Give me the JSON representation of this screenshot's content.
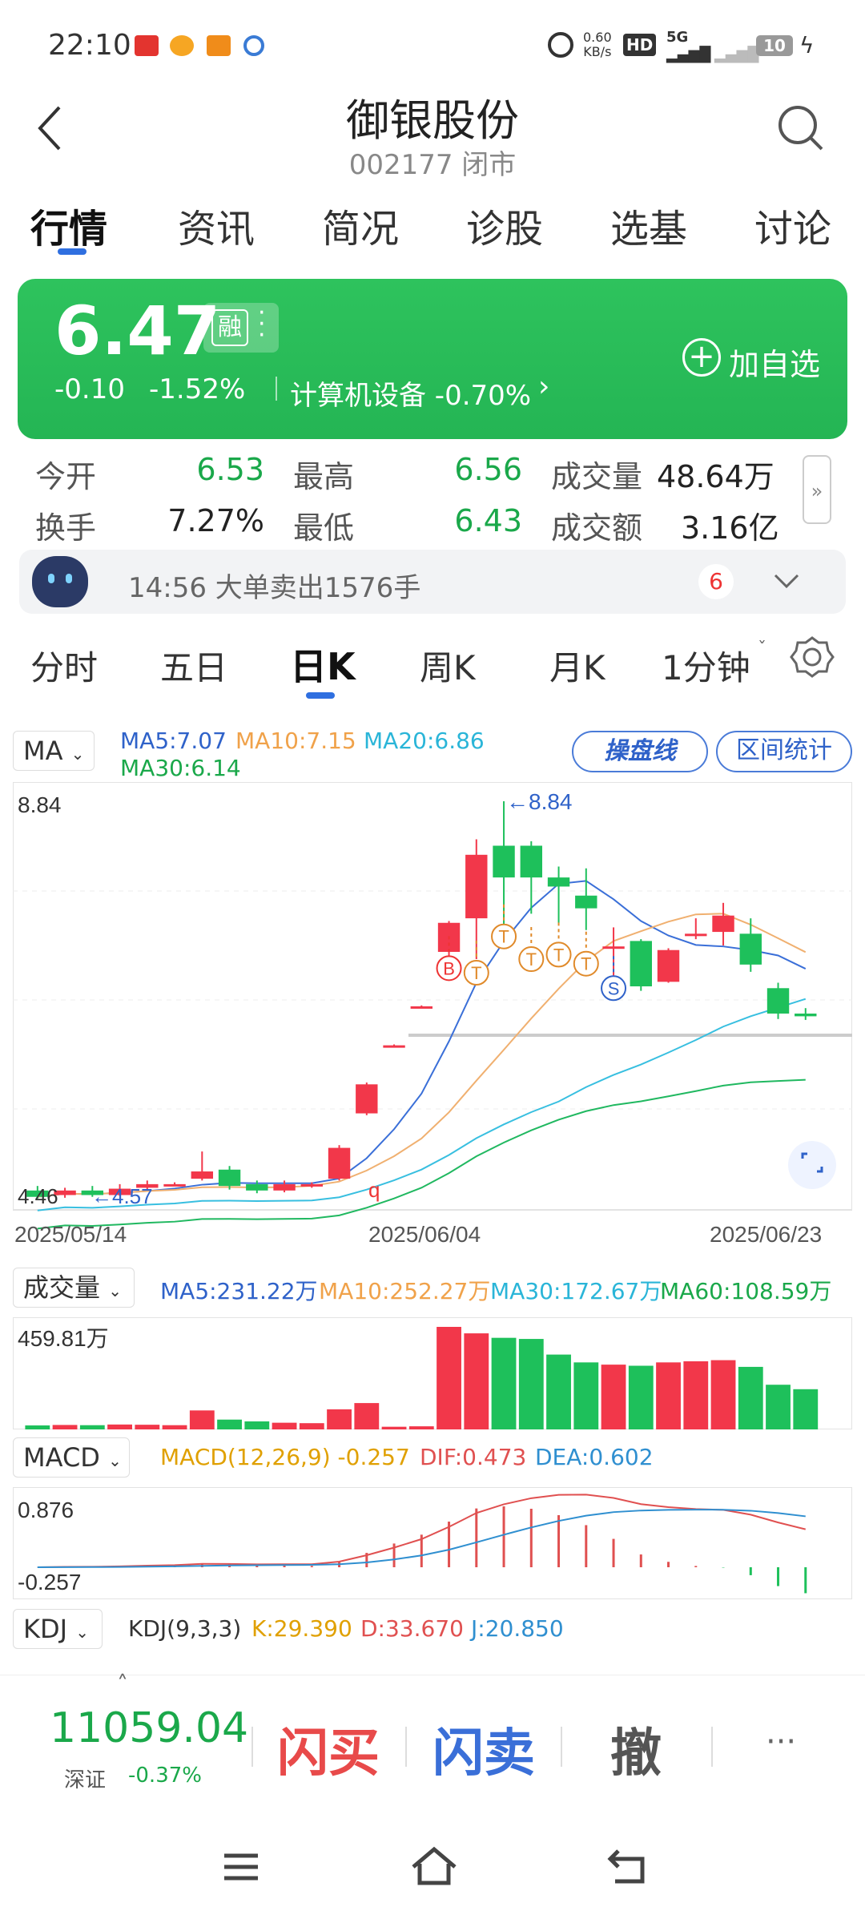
{
  "status": {
    "time": "22:10",
    "net_speed": "0.60",
    "net_unit": "KB/s",
    "hd": "HD",
    "sig": "5G",
    "battery": "10"
  },
  "header": {
    "title": "御银股份",
    "subtitle": "002177 闭市"
  },
  "tabs": [
    "行情",
    "资讯",
    "简况",
    "诊股",
    "选基",
    "讨论"
  ],
  "quote": {
    "price": "6.47",
    "rong": "融",
    "change": "-0.10",
    "pct": "-1.52%",
    "sector": "计算机设备 -0.70%",
    "add_label": "加自选"
  },
  "stats": [
    {
      "label": "今开",
      "value": "6.53"
    },
    {
      "label": "最高",
      "value": "6.56"
    },
    {
      "label": "成交量",
      "value": "48.64万"
    },
    {
      "label": "换手",
      "value": "7.27%"
    },
    {
      "label": "最低",
      "value": "6.43"
    },
    {
      "label": "成交额",
      "value": "3.16亿"
    }
  ],
  "alert": {
    "text": "14:56 大单卖出1576手",
    "badge": "6"
  },
  "period_tabs": [
    "分时",
    "五日",
    "日K",
    "周K",
    "月K",
    "1分钟"
  ],
  "ma": {
    "selector": "MA",
    "ma5": "MA5:7.07",
    "ma10": "MA10:7.15",
    "ma20": "MA20:6.86",
    "ma30": "MA30:6.14",
    "caopan": "操盘线",
    "qujian": "区间统计"
  },
  "kline": {
    "max_label": "8.84",
    "max_arrow": "←8.84",
    "min_label": "4.46",
    "min_arrow": "←4.57",
    "dates": [
      "2025/05/14",
      "2025/06/04",
      "2025/06/23"
    ],
    "signal_q": "q",
    "signals": [
      "B",
      "T",
      "T",
      "T",
      "T",
      "T",
      "S"
    ]
  },
  "volume": {
    "selector": "成交量",
    "ma5": "MA5:231.22万",
    "ma10": "MA10:252.27万",
    "ma30": "MA30:172.67万",
    "ma60": "MA60:108.59万",
    "max_label": "459.81万"
  },
  "macd": {
    "selector": "MACD",
    "params": "MACD(12,26,9) -0.257",
    "dif": "DIF:0.473",
    "dea": "DEA:0.602",
    "top": "0.876",
    "bottom": "-0.257"
  },
  "kdj": {
    "selector": "KDJ",
    "params": "KDJ(9,3,3)",
    "k": "K:29.390",
    "d": "D:33.670",
    "j": "J:20.850"
  },
  "bottom": {
    "index_value": "11059.04",
    "index_name": "深证",
    "index_pct": "-0.37%",
    "buy": "闪买",
    "sell": "闪卖",
    "cancel": "撤",
    "more": "···"
  },
  "chart_data": {
    "type": "candlestick",
    "date_range": [
      "2025/05/14",
      "2025/06/23"
    ],
    "y_range": [
      4.46,
      8.84
    ],
    "candles": [
      {
        "o": 4.55,
        "c": 4.48,
        "h": 4.6,
        "l": 4.46
      },
      {
        "o": 4.5,
        "c": 4.55,
        "h": 4.58,
        "l": 4.47
      },
      {
        "o": 4.55,
        "c": 4.5,
        "h": 4.6,
        "l": 4.48
      },
      {
        "o": 4.5,
        "c": 4.57,
        "h": 4.62,
        "l": 4.49
      },
      {
        "o": 4.58,
        "c": 4.62,
        "h": 4.66,
        "l": 4.55
      },
      {
        "o": 4.62,
        "c": 4.62,
        "h": 4.64,
        "l": 4.6
      },
      {
        "o": 4.68,
        "c": 4.76,
        "h": 4.98,
        "l": 4.66
      },
      {
        "o": 4.78,
        "c": 4.6,
        "h": 4.82,
        "l": 4.56
      },
      {
        "o": 4.62,
        "c": 4.55,
        "h": 4.66,
        "l": 4.52
      },
      {
        "o": 4.55,
        "c": 4.62,
        "h": 4.66,
        "l": 4.53
      },
      {
        "o": 4.6,
        "c": 4.62,
        "h": 4.64,
        "l": 4.58
      },
      {
        "o": 4.68,
        "c": 5.02,
        "h": 5.05,
        "l": 4.66
      },
      {
        "o": 5.4,
        "c": 5.72,
        "h": 5.74,
        "l": 5.38
      },
      {
        "o": 6.15,
        "c": 6.15,
        "h": 6.16,
        "l": 6.14
      },
      {
        "o": 6.58,
        "c": 6.58,
        "h": 6.59,
        "l": 6.57
      },
      {
        "o": 7.18,
        "c": 7.5,
        "h": 7.52,
        "l": 7.1
      },
      {
        "o": 7.55,
        "c": 8.25,
        "h": 8.42,
        "l": 7.1
      },
      {
        "o": 8.35,
        "c": 8.0,
        "h": 8.84,
        "l": 7.42
      },
      {
        "o": 8.35,
        "c": 8.0,
        "h": 8.4,
        "l": 7.6
      },
      {
        "o": 8.0,
        "c": 7.9,
        "h": 8.12,
        "l": 7.5
      },
      {
        "o": 7.8,
        "c": 7.66,
        "h": 8.1,
        "l": 7.42
      },
      {
        "o": 7.24,
        "c": 7.24,
        "h": 7.45,
        "l": 6.92
      },
      {
        "o": 7.3,
        "c": 6.8,
        "h": 7.32,
        "l": 6.75
      },
      {
        "o": 6.85,
        "c": 7.2,
        "h": 7.22,
        "l": 6.84
      },
      {
        "o": 7.38,
        "c": 7.38,
        "h": 7.55,
        "l": 7.32
      },
      {
        "o": 7.4,
        "c": 7.58,
        "h": 7.72,
        "l": 7.25
      },
      {
        "o": 7.38,
        "c": 7.04,
        "h": 7.55,
        "l": 6.96
      },
      {
        "o": 6.78,
        "c": 6.5,
        "h": 6.84,
        "l": 6.44
      },
      {
        "o": 6.5,
        "c": 6.47,
        "h": 6.56,
        "l": 6.43
      }
    ],
    "volume_series": [
      18,
      20,
      19,
      22,
      21,
      19,
      85,
      44,
      36,
      30,
      28,
      90,
      118,
      12,
      14,
      459,
      430,
      410,
      405,
      335,
      300,
      290,
      285,
      300,
      305,
      310,
      280,
      200,
      180
    ]
  }
}
